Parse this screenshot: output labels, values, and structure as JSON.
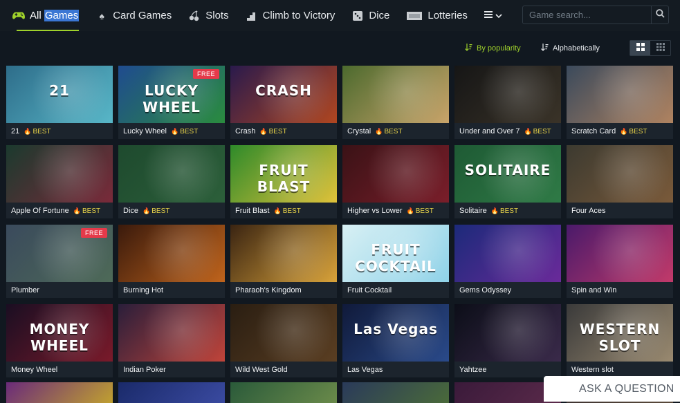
{
  "nav": {
    "tabs": [
      {
        "label_a": "All",
        "label_b": "Games",
        "icon": "gamepad-icon"
      },
      {
        "label": "Card Games",
        "icon": "spade-icon"
      },
      {
        "label": "Slots",
        "icon": "cherries-icon"
      },
      {
        "label": "Climb to Victory",
        "icon": "stairs-icon"
      },
      {
        "label": "Dice",
        "icon": "dice-icon"
      },
      {
        "label": "Lotteries",
        "icon": "ticket-icon"
      }
    ],
    "more_icon": "menu-chevron-icon"
  },
  "search": {
    "placeholder": "Game search..."
  },
  "sort": {
    "popularity": "By popularity",
    "alphabetical": "Alphabetically"
  },
  "games": [
    {
      "name": "21",
      "badge": "BEST",
      "art": "21",
      "colors": [
        "#2e6d8a",
        "#58b7c8"
      ]
    },
    {
      "name": "Lucky Wheel",
      "badge": "BEST",
      "art": "LUCKY WHEEL",
      "free": "FREE",
      "colors": [
        "#1f4b8f",
        "#2a8c3e"
      ]
    },
    {
      "name": "Crash",
      "badge": "BEST",
      "art": "CRASH",
      "colors": [
        "#2a1a4c",
        "#b04620"
      ]
    },
    {
      "name": "Crystal",
      "badge": "BEST",
      "art": "",
      "colors": [
        "#4c6a2e",
        "#c9a46a"
      ]
    },
    {
      "name": "Under and Over 7",
      "badge": "BEST",
      "art": "",
      "colors": [
        "#161616",
        "#3a3328"
      ]
    },
    {
      "name": "Scratch Card",
      "badge": "BEST",
      "art": "",
      "colors": [
        "#3b4a5c",
        "#b08360"
      ]
    },
    {
      "name": "Apple Of Fortune",
      "badge": "BEST",
      "art": "",
      "colors": [
        "#1b3a2e",
        "#7a2a3a"
      ]
    },
    {
      "name": "Dice",
      "badge": "BEST",
      "art": "",
      "colors": [
        "#1e4a2e",
        "#2c5f3a"
      ]
    },
    {
      "name": "Fruit Blast",
      "badge": "BEST",
      "art": "FRUIT BLAST",
      "colors": [
        "#2e8a2a",
        "#e0c23a"
      ]
    },
    {
      "name": "Higher vs Lower",
      "badge": "BEST",
      "art": "",
      "colors": [
        "#3a1216",
        "#7a1e2a"
      ]
    },
    {
      "name": "Solitaire",
      "badge": "BEST",
      "art": "SOLITAIRE",
      "colors": [
        "#1e5a34",
        "#2f7a46"
      ]
    },
    {
      "name": "Four Aces",
      "badge": "",
      "art": "",
      "colors": [
        "#3c3a30",
        "#7a5a3a"
      ]
    },
    {
      "name": "Plumber",
      "badge": "",
      "art": "",
      "free": "FREE",
      "colors": [
        "#3a4a5c",
        "#4e6a58"
      ]
    },
    {
      "name": "Burning Hot",
      "badge": "",
      "art": "",
      "colors": [
        "#3a1a0c",
        "#c0641c"
      ]
    },
    {
      "name": "Pharaoh's Kingdom",
      "badge": "",
      "art": "",
      "colors": [
        "#3a2412",
        "#d9a33a"
      ]
    },
    {
      "name": "Fruit Cocktail",
      "badge": "",
      "art": "FRUIT COCKTAIL",
      "colors": [
        "#d8f0f4",
        "#8fd2e8"
      ]
    },
    {
      "name": "Gems Odyssey",
      "badge": "",
      "art": "",
      "colors": [
        "#1c2a7a",
        "#6a2a9a"
      ]
    },
    {
      "name": "Spin and Win",
      "badge": "",
      "art": "",
      "colors": [
        "#4a1a6a",
        "#c23a6a"
      ]
    },
    {
      "name": "Money Wheel",
      "badge": "",
      "art": "MONEY WHEEL",
      "colors": [
        "#1a0e22",
        "#7a1a2a"
      ]
    },
    {
      "name": "Indian Poker",
      "badge": "",
      "art": "",
      "colors": [
        "#2a1e3a",
        "#c0443a"
      ]
    },
    {
      "name": "Wild West Gold",
      "badge": "",
      "art": "",
      "colors": [
        "#2a1e12",
        "#5a3e22"
      ]
    },
    {
      "name": "Las Vegas",
      "badge": "",
      "art": "Las Vegas",
      "colors": [
        "#101a3a",
        "#2a4a8a"
      ]
    },
    {
      "name": "Yahtzee",
      "badge": "",
      "art": "",
      "colors": [
        "#0c0e18",
        "#3a2a4a"
      ]
    },
    {
      "name": "Western slot",
      "badge": "",
      "art": "WESTERN SLOT",
      "colors": [
        "#3a3a3a",
        "#9a8a70"
      ]
    }
  ],
  "partial_row_colors": [
    [
      "#6a2a7a",
      "#c0a030"
    ],
    [
      "#1a2a6a",
      "#3a4aa0"
    ],
    [
      "#2a5a3a",
      "#6a8a4a"
    ],
    [
      "#2a3a5a",
      "#4a6a3a"
    ],
    [
      "#3a1a3a",
      "#5a2a4a"
    ],
    [
      "#3a3030",
      "#5a4a3a"
    ]
  ],
  "ask": {
    "label": "ASK A QUESTION"
  }
}
